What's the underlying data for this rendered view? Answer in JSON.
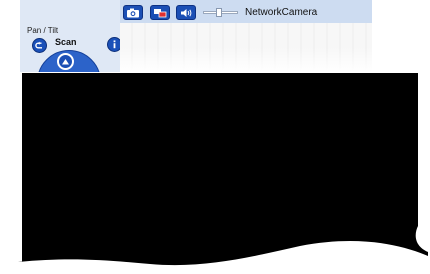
{
  "panel": {
    "pan_tilt_label": "Pan / Tilt",
    "scan_label": "Scan"
  },
  "toolbar": {
    "camera_name": "NetworkCamera",
    "volume_level": 0.45
  },
  "icons": {
    "home": "home-return-icon",
    "info": "info-icon",
    "up": "arrow-up-icon",
    "snapshot": "camera-icon",
    "multi": "multi-screen-icon",
    "audio": "speaker-icon"
  },
  "colors": {
    "panel_bg": "#dfe8f5",
    "toolbar_bg": "#cddcf1",
    "button_blue": "#1b4fb5",
    "overlay": "#000000"
  }
}
